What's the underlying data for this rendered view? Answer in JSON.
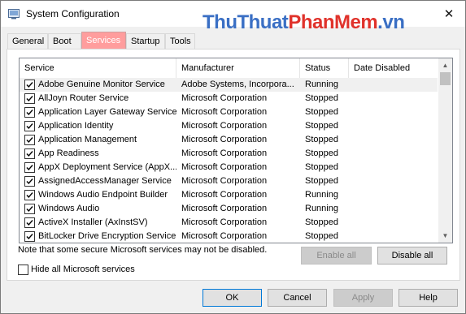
{
  "window": {
    "title": "System Configuration",
    "close_glyph": "✕"
  },
  "watermark": {
    "part1": "ThuThuat",
    "part2": "PhanMem",
    "part3": ".vn"
  },
  "tabs": [
    {
      "label": "General",
      "active": false
    },
    {
      "label": "Boot",
      "active": false
    },
    {
      "label": "Services",
      "active": true
    },
    {
      "label": "Startup",
      "active": false
    },
    {
      "label": "Tools",
      "active": false
    }
  ],
  "services": {
    "columns": [
      "Service",
      "Manufacturer",
      "Status",
      "Date Disabled"
    ],
    "rows": [
      {
        "name": "Adobe Genuine Monitor Service",
        "manufacturer": "Adobe Systems, Incorpora...",
        "status": "Running",
        "checked": true,
        "selected": true
      },
      {
        "name": "AllJoyn Router Service",
        "manufacturer": "Microsoft Corporation",
        "status": "Stopped",
        "checked": true
      },
      {
        "name": "Application Layer Gateway Service",
        "manufacturer": "Microsoft Corporation",
        "status": "Stopped",
        "checked": true
      },
      {
        "name": "Application Identity",
        "manufacturer": "Microsoft Corporation",
        "status": "Stopped",
        "checked": true
      },
      {
        "name": "Application Management",
        "manufacturer": "Microsoft Corporation",
        "status": "Stopped",
        "checked": true
      },
      {
        "name": "App Readiness",
        "manufacturer": "Microsoft Corporation",
        "status": "Stopped",
        "checked": true
      },
      {
        "name": "AppX Deployment Service (AppX...",
        "manufacturer": "Microsoft Corporation",
        "status": "Stopped",
        "checked": true
      },
      {
        "name": "AssignedAccessManager Service",
        "manufacturer": "Microsoft Corporation",
        "status": "Stopped",
        "checked": true
      },
      {
        "name": "Windows Audio Endpoint Builder",
        "manufacturer": "Microsoft Corporation",
        "status": "Running",
        "checked": true
      },
      {
        "name": "Windows Audio",
        "manufacturer": "Microsoft Corporation",
        "status": "Running",
        "checked": true
      },
      {
        "name": "ActiveX Installer (AxInstSV)",
        "manufacturer": "Microsoft Corporation",
        "status": "Stopped",
        "checked": true
      },
      {
        "name": "BitLocker Drive Encryption Service",
        "manufacturer": "Microsoft Corporation",
        "status": "Stopped",
        "checked": true
      }
    ]
  },
  "note": "Note that some secure Microsoft services may not be disabled.",
  "enable_all": "Enable all",
  "disable_all": "Disable all",
  "hide_ms_label": "Hide all Microsoft services",
  "buttons": {
    "ok": "OK",
    "cancel": "Cancel",
    "apply": "Apply",
    "help": "Help"
  },
  "icons": {
    "app": "system-configuration-icon",
    "close": "close-icon",
    "check": "checkmark-icon"
  }
}
